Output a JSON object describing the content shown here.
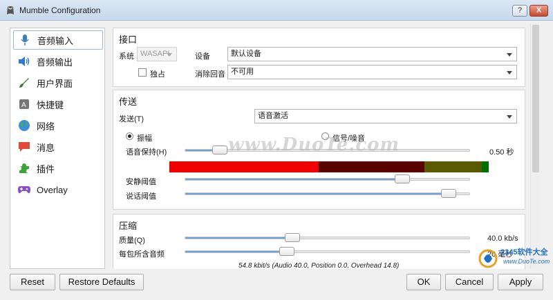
{
  "window": {
    "title": "Mumble Configuration",
    "help_label": "?",
    "close_label": "X"
  },
  "sidebar": {
    "items": [
      {
        "label": "音频输入",
        "icon": "microphone-icon"
      },
      {
        "label": "音频输出",
        "icon": "speaker-icon"
      },
      {
        "label": "用户界面",
        "icon": "brush-icon"
      },
      {
        "label": "快捷键",
        "icon": "keyboard-key-icon"
      },
      {
        "label": "网络",
        "icon": "globe-icon"
      },
      {
        "label": "消息",
        "icon": "chat-bubble-icon"
      },
      {
        "label": "插件",
        "icon": "puzzle-piece-icon"
      },
      {
        "label": "Overlay",
        "icon": "gamepad-icon"
      }
    ]
  },
  "interface": {
    "title": "接口",
    "system_label": "系统",
    "system_value": "WASAPI",
    "device_label": "设备",
    "device_value": "默认设备",
    "exclusive_label": "独占",
    "echo_label": "消除回音",
    "echo_value": "不可用"
  },
  "transmission": {
    "title": "传送",
    "transmit_label": "发送(T)",
    "transmit_value": "语音激活",
    "amplitude_label": "振幅",
    "snr_label": "信号/噪音",
    "voice_hold_label": "语音保持(H)",
    "voice_hold_value": "0.50 秒",
    "voice_hold_level": 0.1,
    "silence_label": "安静阈值",
    "silence_level": 0.78,
    "speech_label": "说话阈值",
    "speech_level": 0.95
  },
  "compression": {
    "title": "压缩",
    "quality_label": "质量(Q)",
    "quality_value": "40.0 kb/s",
    "quality_level": 0.37,
    "frames_label": "每包所含音频",
    "frames_value": "20 毫秒",
    "frames_level": 0.35,
    "summary": "54.8 kbit/s (Audio 40.0, Position 0.0, Overhead 14.8)"
  },
  "buttons": {
    "reset": "Reset",
    "restore": "Restore Defaults",
    "ok": "OK",
    "cancel": "Cancel",
    "apply": "Apply"
  },
  "watermark": {
    "text": "www.DuoTe.com",
    "corner_brand": "2345软件大全",
    "corner_url": "www.DuoTe.com"
  },
  "colors": {
    "meter_red": "#f00000",
    "meter_dark_red": "#5a0000",
    "meter_olive": "#5a5a00",
    "meter_green": "#007000",
    "slider_accent": "#6fa0d8"
  }
}
